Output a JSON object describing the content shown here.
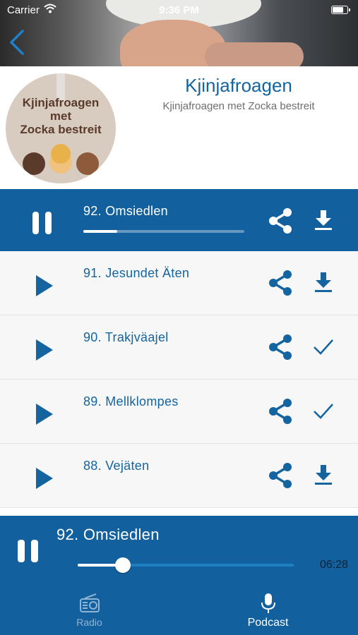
{
  "status_bar": {
    "carrier": "Carrier",
    "time": "9:36 PM"
  },
  "podcast": {
    "title": "Kjinjafroagen",
    "subtitle": "Kjinjafroagen met Zocka bestreit",
    "cover_text_line1": "Kjinjafroagen",
    "cover_text_line2": "met",
    "cover_text_line3": "Zocka bestreit"
  },
  "episodes": [
    {
      "title": "92. Omsiedlen",
      "state": "playing",
      "progress": 0.21,
      "action": "download-icon"
    },
    {
      "title": "91. Jesundet Äten",
      "state": "paused",
      "action": "download-icon"
    },
    {
      "title": "90. Trakjväajel",
      "state": "paused",
      "action": "checkmark-icon"
    },
    {
      "title": "89. Mellklompes",
      "state": "paused",
      "action": "checkmark-icon"
    },
    {
      "title": "88. Vejäten",
      "state": "paused",
      "action": "download-icon"
    }
  ],
  "player": {
    "title": "92. Omsiedlen",
    "duration": "06:28",
    "position": 0.21
  },
  "tabs": {
    "radio": "Radio",
    "podcast": "Podcast"
  },
  "colors": {
    "brand": "#13609e",
    "accent": "#1464a0",
    "row_bg": "#f7f7f7"
  }
}
